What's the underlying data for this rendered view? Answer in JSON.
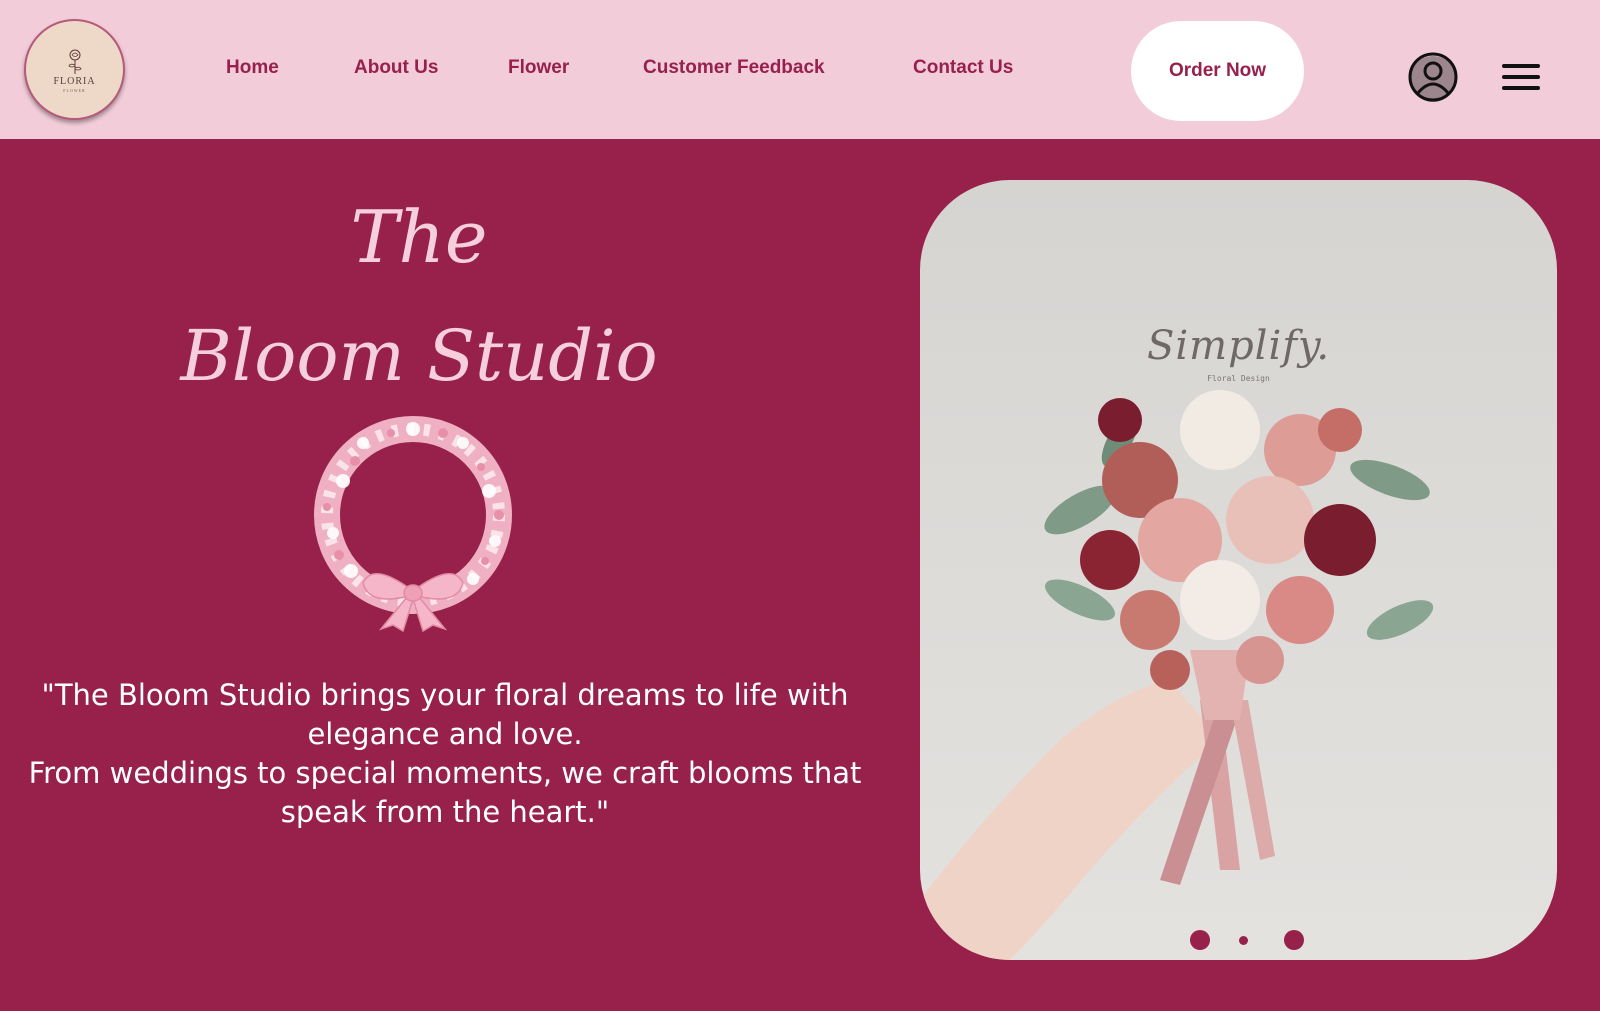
{
  "logo": {
    "name": "FLORIA",
    "subtext": "FLOWER"
  },
  "nav": {
    "items": [
      {
        "label": "Home"
      },
      {
        "label": "About Us"
      },
      {
        "label": "Flower"
      },
      {
        "label": "Customer Feedback"
      },
      {
        "label": "Contact Us"
      }
    ],
    "order_label": "Order Now",
    "account_icon": "user-circle-icon",
    "menu_icon": "hamburger-menu-icon"
  },
  "hero": {
    "title_line1": "The",
    "title_line2": "Bloom Studio",
    "quote_line1": "\"The Bloom Studio brings your floral dreams to life with elegance and love.",
    "quote_line2": "From weddings to special moments, we craft blooms that speak from the heart.\"",
    "photo": {
      "brand": "Simplify.",
      "brand_sub": "Floral Design",
      "slides_count": 3,
      "active_slide": 2
    }
  },
  "colors": {
    "header_bg": "#f2cdd9",
    "hero_bg": "#97214b",
    "accent": "#97204d",
    "title_pink": "#f5cfdc"
  }
}
